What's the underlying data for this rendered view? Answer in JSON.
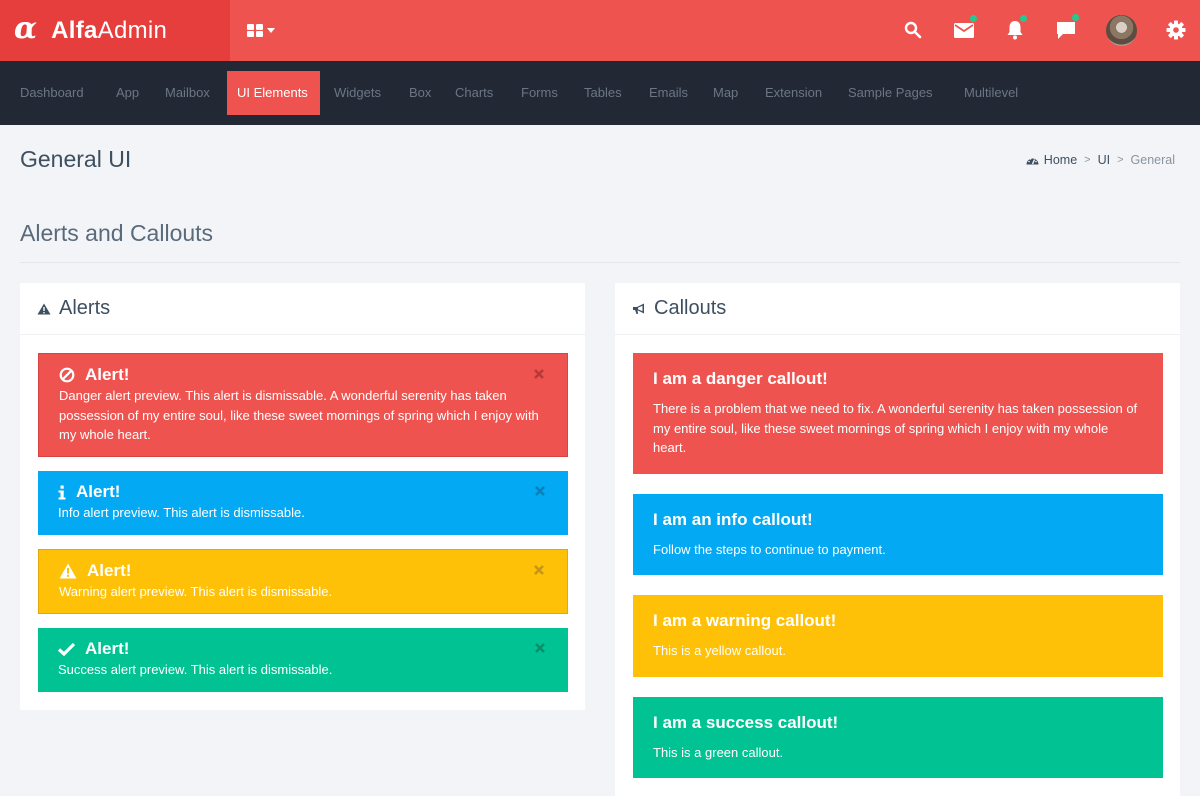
{
  "header": {
    "logo_symbol": "α",
    "logo_bold": "Alfa",
    "logo_light": "Admin",
    "apps_menu_icon": "grid-icon",
    "icons": [
      {
        "name": "search-icon",
        "badge": false
      },
      {
        "name": "mail-icon",
        "badge": true
      },
      {
        "name": "bell-icon",
        "badge": true
      },
      {
        "name": "chat-icon",
        "badge": true
      },
      {
        "name": "user-avatar",
        "badge": false
      },
      {
        "name": "gear-icon",
        "badge": false
      }
    ],
    "colors": {
      "header_bg": "#ef5350",
      "logo_bg": "#e53e3c",
      "badge": "#22c993",
      "nav_bg": "#232934"
    }
  },
  "nav": {
    "items": [
      {
        "label": "Dashboard",
        "active": false
      },
      {
        "label": "App",
        "active": false
      },
      {
        "label": "Mailbox",
        "active": false
      },
      {
        "label": "UI Elements",
        "active": true
      },
      {
        "label": "Widgets",
        "active": false
      },
      {
        "label": "Box",
        "active": false
      },
      {
        "label": "Charts",
        "active": false
      },
      {
        "label": "Forms",
        "active": false
      },
      {
        "label": "Tables",
        "active": false
      },
      {
        "label": "Emails",
        "active": false
      },
      {
        "label": "Map",
        "active": false
      },
      {
        "label": "Extension",
        "active": false
      },
      {
        "label": "Sample Pages",
        "active": false
      },
      {
        "label": "Multilevel",
        "active": false
      }
    ]
  },
  "page": {
    "title": "General UI",
    "breadcrumb": [
      {
        "label": "Home",
        "icon": "dashboard-gauge-icon"
      },
      {
        "label": "UI"
      },
      {
        "label": "General"
      }
    ],
    "breadcrumb_separator": ">",
    "section_title": "Alerts and Callouts"
  },
  "alerts_box": {
    "title": "Alerts",
    "icon": "warning-icon",
    "alerts": [
      {
        "type": "danger",
        "icon": "ban-icon",
        "title": "Alert!",
        "text": "Danger alert preview. This alert is dismissable. A wonderful serenity has taken possession of my entire soul, like these sweet mornings of spring which I enjoy with my whole heart.",
        "color": "#ef5350",
        "close": "×"
      },
      {
        "type": "info",
        "icon": "info-icon",
        "title": "Alert!",
        "text": "Info alert preview. This alert is dismissable.",
        "color": "#03a9f3",
        "close": "×"
      },
      {
        "type": "warning",
        "icon": "warning-icon",
        "title": "Alert!",
        "text": "Warning alert preview. This alert is dismissable.",
        "color": "#fec107",
        "close": "×"
      },
      {
        "type": "success",
        "icon": "check-icon",
        "title": "Alert!",
        "text": "Success alert preview. This alert is dismissable.",
        "color": "#00c292",
        "close": "×"
      }
    ]
  },
  "callouts_box": {
    "title": "Callouts",
    "icon": "bullhorn-icon",
    "callouts": [
      {
        "type": "danger",
        "title": "I am a danger callout!",
        "text": "There is a problem that we need to fix. A wonderful serenity has taken possession of my entire soul, like these sweet mornings of spring which I enjoy with my whole heart.",
        "color": "#ef5350"
      },
      {
        "type": "info",
        "title": "I am an info callout!",
        "text": "Follow the steps to continue to payment.",
        "color": "#03a9f3"
      },
      {
        "type": "warning",
        "title": "I am a warning callout!",
        "text": "This is a yellow callout.",
        "color": "#fec107"
      },
      {
        "type": "success",
        "title": "I am a success callout!",
        "text": "This is a green callout.",
        "color": "#00c292"
      }
    ]
  }
}
